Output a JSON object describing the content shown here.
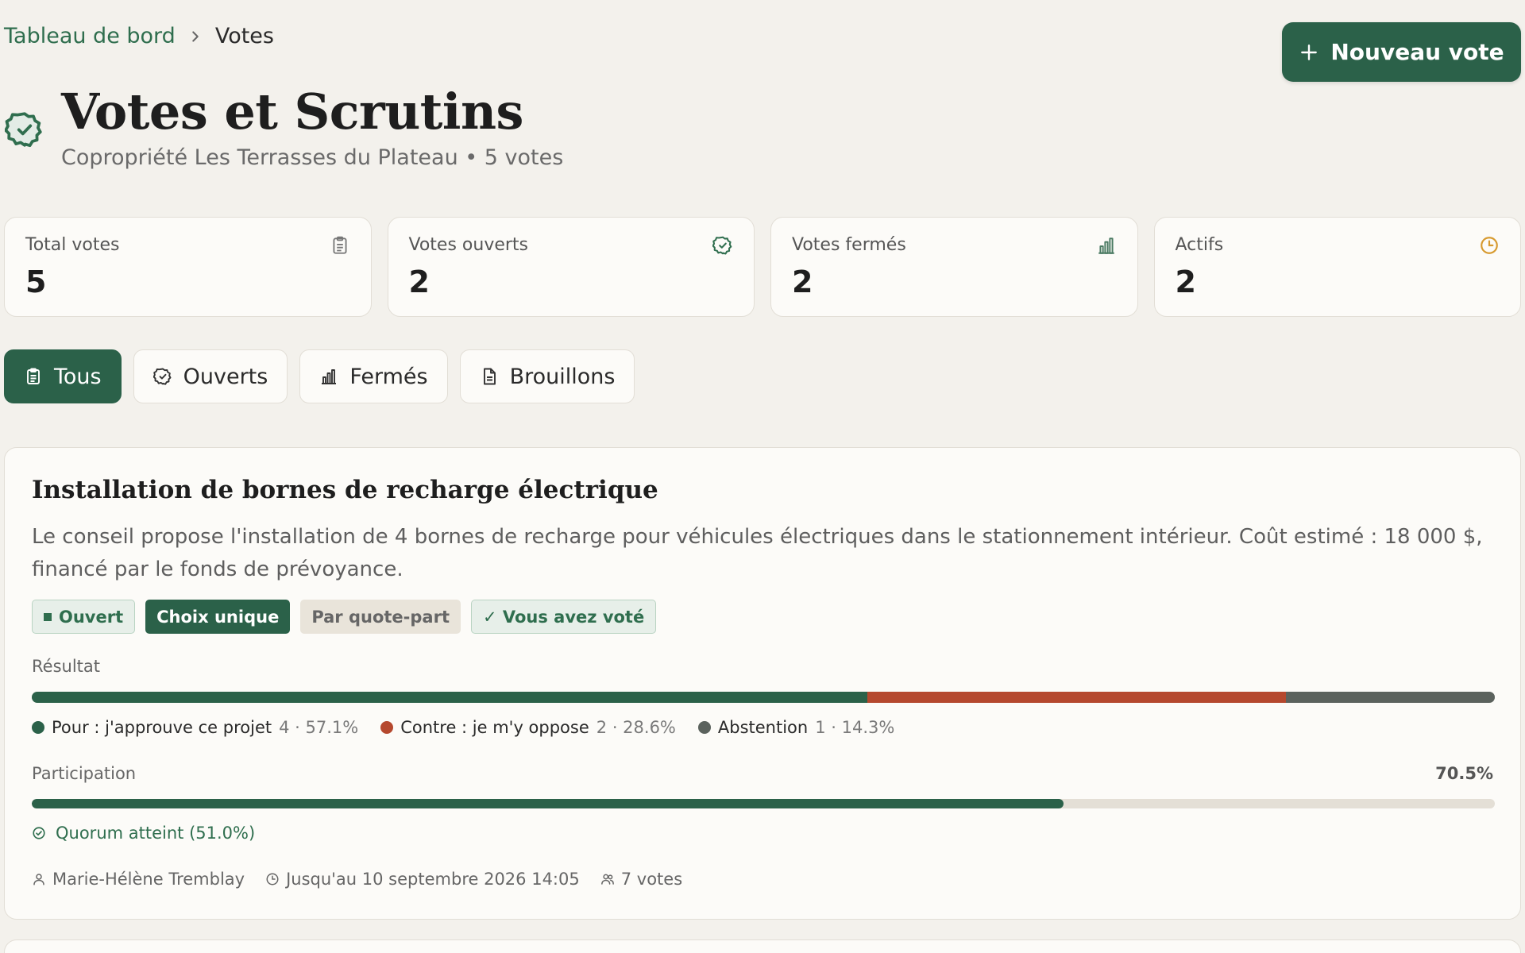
{
  "breadcrumb": {
    "parent": "Tableau de bord",
    "current": "Votes"
  },
  "header": {
    "title": "Votes et Scrutins",
    "subtitle": "Copropriété Les Terrasses du Plateau • 5 votes",
    "new_vote_label": "Nouveau vote"
  },
  "stats": [
    {
      "label": "Total votes",
      "value": "5",
      "icon": "clipboard-icon"
    },
    {
      "label": "Votes ouverts",
      "value": "2",
      "icon": "badge-check-icon"
    },
    {
      "label": "Votes fermés",
      "value": "2",
      "icon": "bar-chart-icon"
    },
    {
      "label": "Actifs",
      "value": "2",
      "icon": "clock-icon"
    }
  ],
  "filters": [
    {
      "label": "Tous",
      "active": true,
      "icon": "clipboard-icon"
    },
    {
      "label": "Ouverts",
      "active": false,
      "icon": "badge-check-icon"
    },
    {
      "label": "Fermés",
      "active": false,
      "icon": "bar-chart-icon"
    },
    {
      "label": "Brouillons",
      "active": false,
      "icon": "document-icon"
    }
  ],
  "vote": {
    "title": "Installation de bornes de recharge électrique",
    "description": "Le conseil propose l'installation de 4 bornes de recharge pour véhicules électriques dans le stationnement intérieur. Coût estimé : 18 000 $, financé par le fonds de prévoyance.",
    "badges": {
      "status": "Ouvert",
      "choice": "Choix unique",
      "weighting": "Par quote-part",
      "voted": "✓ Vous avez voté"
    },
    "result_label": "Résultat",
    "results": [
      {
        "name": "Pour : j'approuve ce projet",
        "stat": "4 · 57.1%",
        "percent": 57.1,
        "color": "#2b6149"
      },
      {
        "name": "Contre : je m'y oppose",
        "stat": "2 · 28.6%",
        "percent": 28.6,
        "color": "#b5482e"
      },
      {
        "name": "Abstention",
        "stat": "1 · 14.3%",
        "percent": 14.3,
        "color": "#5b625d"
      }
    ],
    "participation_label": "Participation",
    "participation_value": "70.5%",
    "participation_percent": 70.5,
    "quorum_text": "Quorum atteint (51.0%)",
    "author": "Marie-Hélène Tremblay",
    "deadline": "Jusqu'au 10 septembre 2026 14:05",
    "votes_count": "7 votes"
  },
  "colors": {
    "primary": "#2b6149",
    "against": "#b5482e",
    "abstain": "#5b625d",
    "background": "#f3f1ec"
  }
}
